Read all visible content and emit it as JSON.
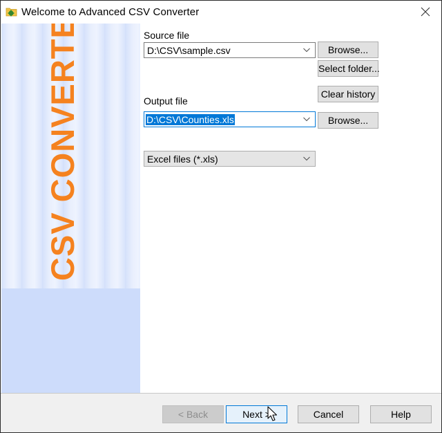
{
  "window": {
    "title": "Welcome to Advanced CSV Converter",
    "app_icon": "folder-gear-icon",
    "close_icon": "close-icon"
  },
  "banner": {
    "text": "CSV CONVERTER",
    "text_color": "#f5821f",
    "background_color": "#cddcfb"
  },
  "source": {
    "label": "Source file",
    "value": "D:\\CSV\\sample.csv",
    "browse_label": "Browse...",
    "select_folder_label": "Select folder..."
  },
  "output": {
    "label": "Output file",
    "value": "D:\\CSV\\Counties.xls",
    "value_selected": true,
    "clear_history_label": "Clear history",
    "browse_label": "Browse..."
  },
  "format": {
    "selected": "Excel files (*.xls)"
  },
  "footer": {
    "back_label": "< Back",
    "back_enabled": false,
    "next_label": "Next >",
    "cancel_label": "Cancel",
    "help_label": "Help"
  },
  "colors": {
    "accent": "#0078d7",
    "button_bg": "#e1e1e1",
    "footer_bg": "#f0f0f0"
  }
}
